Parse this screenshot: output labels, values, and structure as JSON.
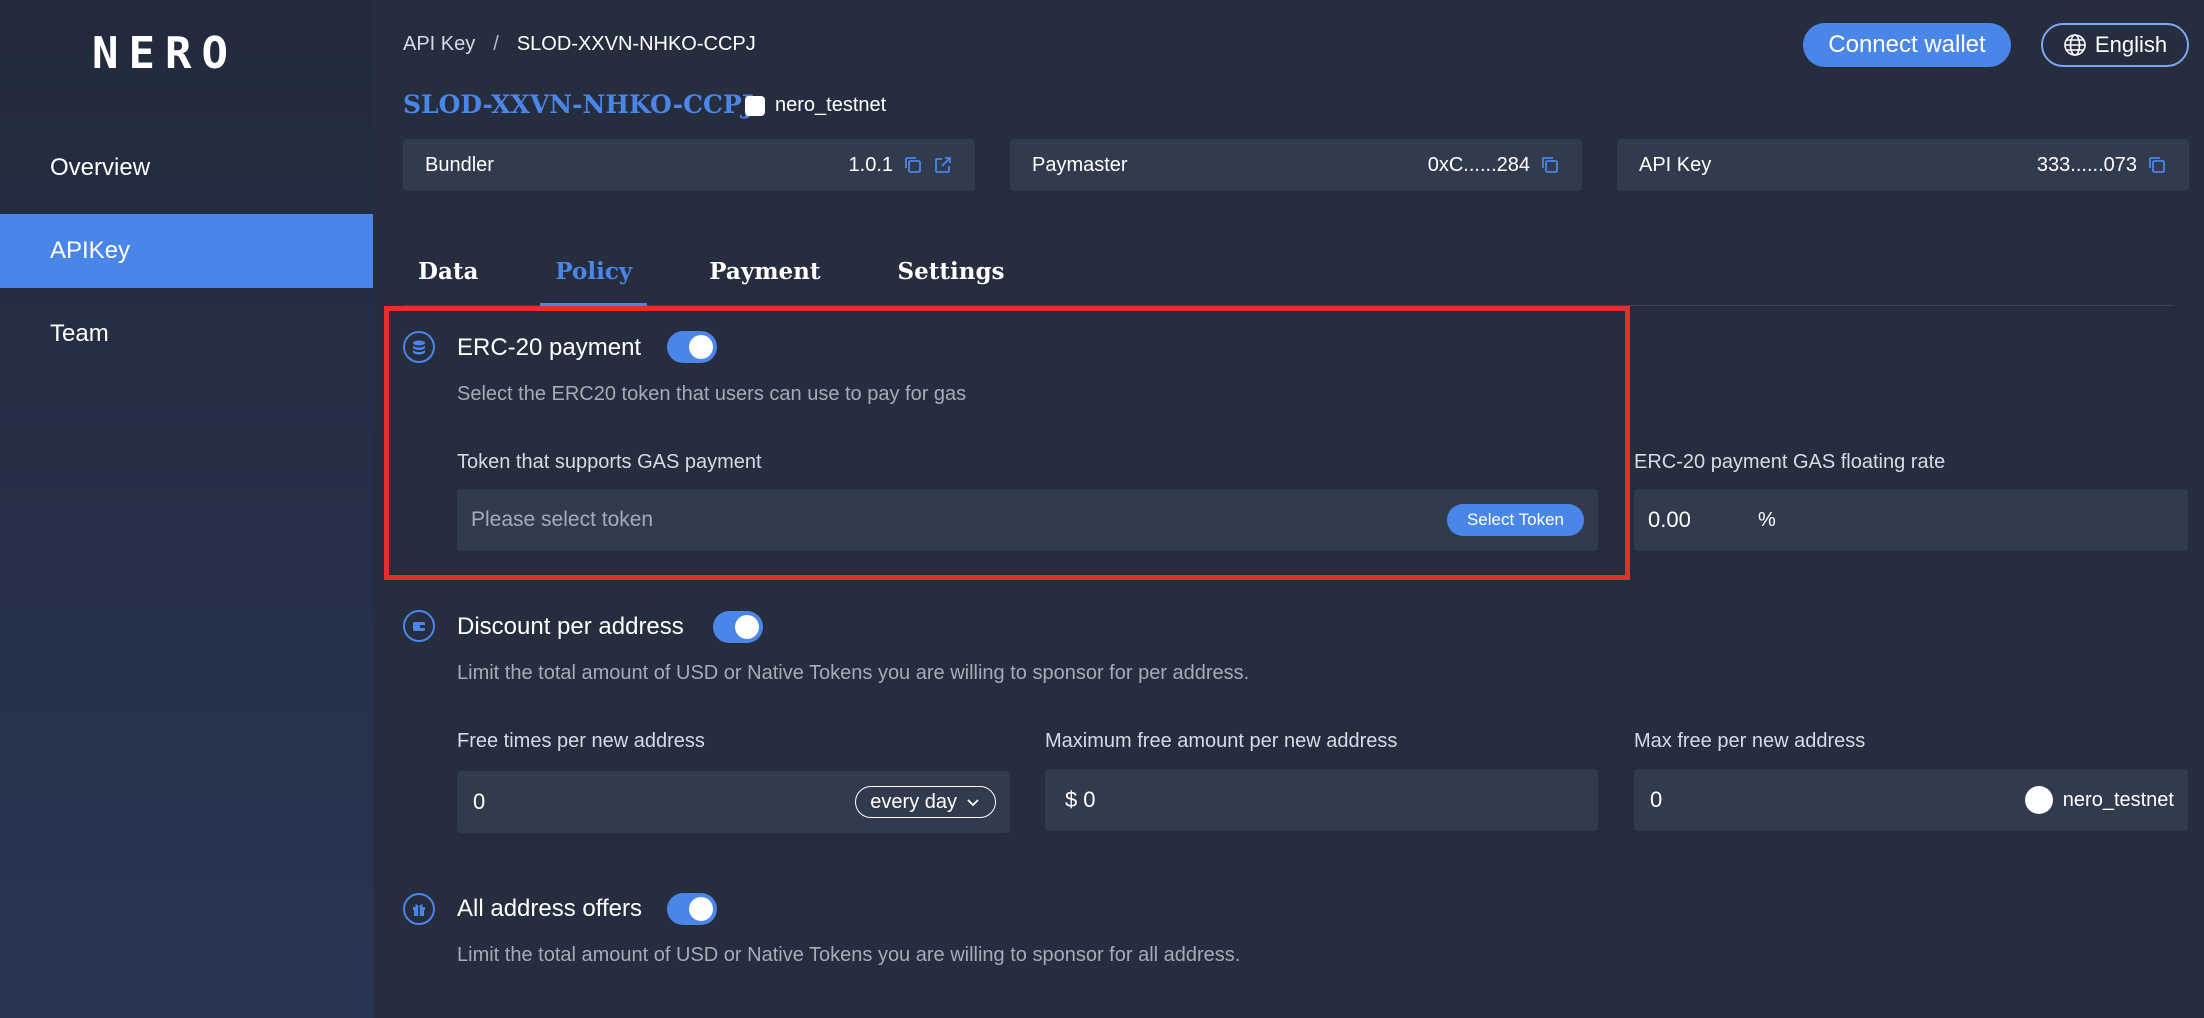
{
  "sidebar": {
    "logo": [
      "N",
      "E",
      "R",
      "O"
    ],
    "items": [
      {
        "label": "Overview"
      },
      {
        "label": "APIKey"
      },
      {
        "label": "Team"
      }
    ]
  },
  "header": {
    "breadcrumb": [
      "API Key",
      "/",
      "SLOD-XXVN-NHKO-CCPJ"
    ],
    "connect_label": "Connect wallet",
    "language": "English",
    "title": "SLOD-XXVN-NHKO-CCPJ",
    "network": "nero_testnet"
  },
  "info_cards": [
    {
      "label": "Bundler",
      "value": "1.0.1"
    },
    {
      "label": "Paymaster",
      "value": "0xC......284"
    },
    {
      "label": "API Key",
      "value": "333......073"
    }
  ],
  "tabs": [
    "Data",
    "Policy",
    "Payment",
    "Settings"
  ],
  "erc20": {
    "title": "ERC-20 payment",
    "desc": "Select the ERC20 token that users can use to pay for gas",
    "token_label": "Token that supports GAS payment",
    "token_placeholder": "Please select token",
    "select_btn": "Select Token",
    "rate_label": "ERC-20 payment GAS floating rate",
    "rate_value": "0.00",
    "rate_unit": "%"
  },
  "discount": {
    "title": "Discount per address",
    "desc": "Limit the total amount of USD or Native Tokens you are willing to sponsor for per address.",
    "free_times_label": "Free times per new address",
    "free_times_value": "0",
    "period": "every day",
    "max_amount_label": "Maximum free amount per new address",
    "currency": "$",
    "max_amount_value": "0",
    "max_free_label": "Max free per new address",
    "max_free_value": "0",
    "network": "nero_testnet"
  },
  "all_offers": {
    "title": "All address offers",
    "desc": "Limit the total amount of USD or Native Tokens you are willing to sponsor for all address."
  }
}
